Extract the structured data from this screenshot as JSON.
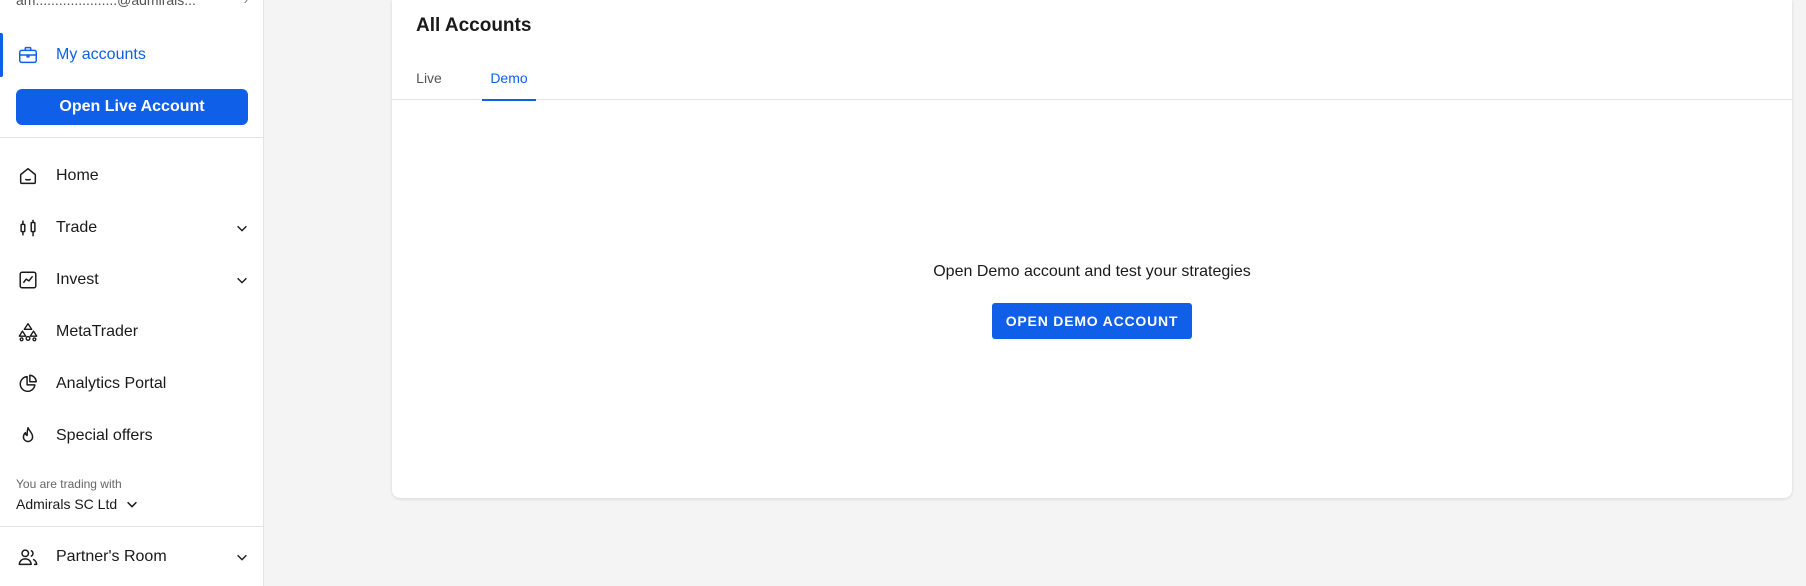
{
  "sidebar": {
    "email": "am.....................@admirals...",
    "my_accounts": "My accounts",
    "open_live_label": "Open Live Account",
    "items": [
      {
        "label": "Home"
      },
      {
        "label": "Trade"
      },
      {
        "label": "Invest"
      },
      {
        "label": "MetaTrader"
      },
      {
        "label": "Analytics Portal"
      },
      {
        "label": "Special offers"
      }
    ],
    "trading_with_label": "You are trading with",
    "entity": "Admirals SC Ltd",
    "partners_room": "Partner's Room"
  },
  "main": {
    "title": "All Accounts",
    "tabs": [
      {
        "label": "Live",
        "active": false
      },
      {
        "label": "Demo",
        "active": true
      }
    ],
    "empty_message": "Open Demo account and test your strategies",
    "open_demo_label": "OPEN DEMO ACCOUNT"
  },
  "colors": {
    "accent": "#0f5fe8",
    "background": "#f4f4f4",
    "surface": "#ffffff"
  },
  "icons": {
    "my_accounts": "briefcase-icon",
    "home": "home-icon",
    "trade": "candlestick-icon",
    "invest": "chart-line-icon",
    "metatrader": "metatrader-icon",
    "analytics": "pie-chart-icon",
    "special_offers": "flame-icon",
    "partners_room": "users-icon"
  }
}
